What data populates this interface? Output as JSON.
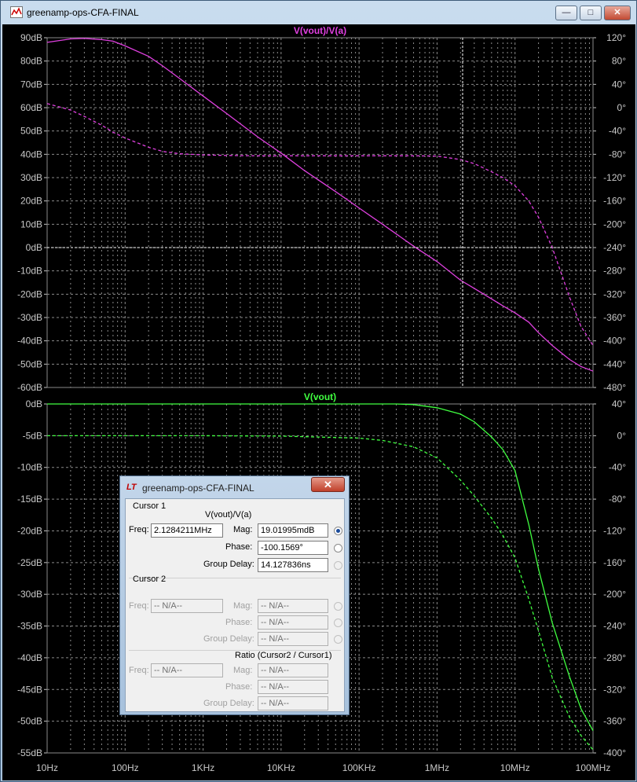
{
  "window": {
    "title": "greenamp-ops-CFA-FINAL",
    "min_glyph": "—",
    "max_glyph": "□",
    "close_glyph": "✕"
  },
  "colors": {
    "magenta": "#e040e0",
    "green": "#40ff40",
    "grid": "#8a8a8a",
    "label": "#c8c8c8"
  },
  "chart_data": [
    {
      "type": "line",
      "title": "V(vout)/V(a)",
      "x_scale": "log",
      "xlim": [
        10,
        100000000
      ],
      "ylim": [
        -60,
        90
      ],
      "y_ticks": [
        "90dB",
        "80dB",
        "70dB",
        "60dB",
        "50dB",
        "40dB",
        "30dB",
        "20dB",
        "10dB",
        "0dB",
        "-10dB",
        "-20dB",
        "-30dB",
        "-40dB",
        "-50dB",
        "-60dB"
      ],
      "y2lim": [
        -480,
        120
      ],
      "y2_ticks": [
        "120°",
        "80°",
        "40°",
        "0°",
        "-40°",
        "-80°",
        "-120°",
        "-160°",
        "-200°",
        "-240°",
        "-280°",
        "-320°",
        "-360°",
        "-400°",
        "-440°",
        "-480°"
      ],
      "series": [
        {
          "name": "magnitude",
          "style": "solid",
          "axis": "left",
          "x": [
            10,
            20,
            30,
            50,
            70,
            100,
            200,
            300,
            500,
            1000,
            2000,
            5000,
            10000,
            20000,
            50000,
            100000,
            200000,
            500000,
            1000000,
            2000000,
            3000000,
            5000000,
            7000000,
            10000000,
            15000000,
            20000000,
            30000000,
            50000000,
            70000000,
            100000000
          ],
          "y": [
            88,
            89.5,
            89.7,
            89.2,
            88.5,
            86.5,
            82,
            78,
            72.5,
            65,
            57.5,
            47.5,
            40.5,
            33,
            24,
            17,
            10,
            0.6,
            -6,
            -14,
            -17.5,
            -22,
            -25,
            -28,
            -32,
            -36.5,
            -42,
            -48,
            -51,
            -53
          ]
        },
        {
          "name": "phase",
          "style": "dashed",
          "axis": "right",
          "x": [
            10,
            20,
            30,
            50,
            70,
            100,
            200,
            300,
            500,
            1000,
            2000,
            5000,
            10000,
            20000,
            50000,
            100000,
            200000,
            500000,
            1000000,
            2000000,
            3000000,
            5000000,
            7000000,
            10000000,
            15000000,
            20000000,
            30000000,
            50000000,
            70000000,
            100000000
          ],
          "y": [
            7,
            -4,
            -15,
            -30,
            -42,
            -52,
            -68,
            -75,
            -79,
            -81,
            -82,
            -82.5,
            -82.5,
            -82.5,
            -82.5,
            -82.5,
            -82.5,
            -82.5,
            -83,
            -89,
            -96,
            -110,
            -120,
            -134,
            -160,
            -188,
            -240,
            -325,
            -375,
            -408
          ]
        }
      ]
    },
    {
      "type": "line",
      "title": "V(vout)",
      "x_scale": "log",
      "xlim": [
        10,
        100000000
      ],
      "ylim": [
        -55,
        0
      ],
      "y_ticks": [
        "0dB",
        "-5dB",
        "-10dB",
        "-15dB",
        "-20dB",
        "-25dB",
        "-30dB",
        "-35dB",
        "-40dB",
        "-45dB",
        "-50dB",
        "-55dB"
      ],
      "y2lim": [
        -400,
        40
      ],
      "y2_ticks": [
        "40°",
        "0°",
        "-40°",
        "-80°",
        "-120°",
        "-160°",
        "-200°",
        "-240°",
        "-280°",
        "-320°",
        "-360°",
        "-400°"
      ],
      "x_ticks": [
        "10Hz",
        "100Hz",
        "1KHz",
        "10KHz",
        "100KHz",
        "1MHz",
        "10MHz",
        "100MHz"
      ],
      "series": [
        {
          "name": "magnitude",
          "style": "solid",
          "axis": "left",
          "x": [
            10,
            100,
            1000,
            10000,
            100000,
            300000,
            500000,
            1000000,
            2000000,
            3000000,
            5000000,
            7000000,
            10000000,
            15000000,
            20000000,
            30000000,
            50000000,
            70000000,
            100000000
          ],
          "y": [
            0,
            0,
            0,
            0,
            0,
            0,
            -0.1,
            -0.6,
            -1.6,
            -2.8,
            -5.2,
            -7.2,
            -10.5,
            -19,
            -26,
            -34.5,
            -43,
            -48,
            -51.5
          ]
        },
        {
          "name": "phase",
          "style": "dashed",
          "axis": "right",
          "x": [
            10,
            100,
            1000,
            10000,
            100000,
            200000,
            500000,
            1000000,
            2000000,
            3000000,
            5000000,
            7000000,
            10000000,
            15000000,
            20000000,
            30000000,
            50000000,
            70000000,
            100000000
          ],
          "y": [
            0,
            0,
            0,
            -0.5,
            -3,
            -6,
            -14,
            -28,
            -56,
            -76,
            -104,
            -126,
            -154,
            -206,
            -246,
            -305,
            -355,
            -378,
            -396
          ]
        }
      ]
    }
  ],
  "cursor_dialog": {
    "title": "greenamp-ops-CFA-FINAL",
    "icon": "LT",
    "close_glyph": "✕",
    "cursor1": {
      "heading": "Cursor 1",
      "trace": "V(vout)/V(a)",
      "freq_label": "Freq:",
      "freq": "2.1284211MHz",
      "mag_label": "Mag:",
      "mag": "19.01995mdB",
      "phase_label": "Phase:",
      "phase": "-100.1569°",
      "gd_label": "Group Delay:",
      "gd": "14.127836ns"
    },
    "cursor2": {
      "heading": "Cursor 2",
      "freq_label": "Freq:",
      "freq": "-- N/A--",
      "mag_label": "Mag:",
      "mag": "-- N/A--",
      "phase_label": "Phase:",
      "phase": "-- N/A--",
      "gd_label": "Group Delay:",
      "gd": "-- N/A--"
    },
    "ratio": {
      "heading": "Ratio (Cursor2 / Cursor1)",
      "freq_label": "Freq:",
      "freq": "-- N/A--",
      "mag_label": "Mag:",
      "mag": "-- N/A--",
      "phase_label": "Phase:",
      "phase": "-- N/A--",
      "gd_label": "Group Delay:",
      "gd": "-- N/A--"
    }
  }
}
